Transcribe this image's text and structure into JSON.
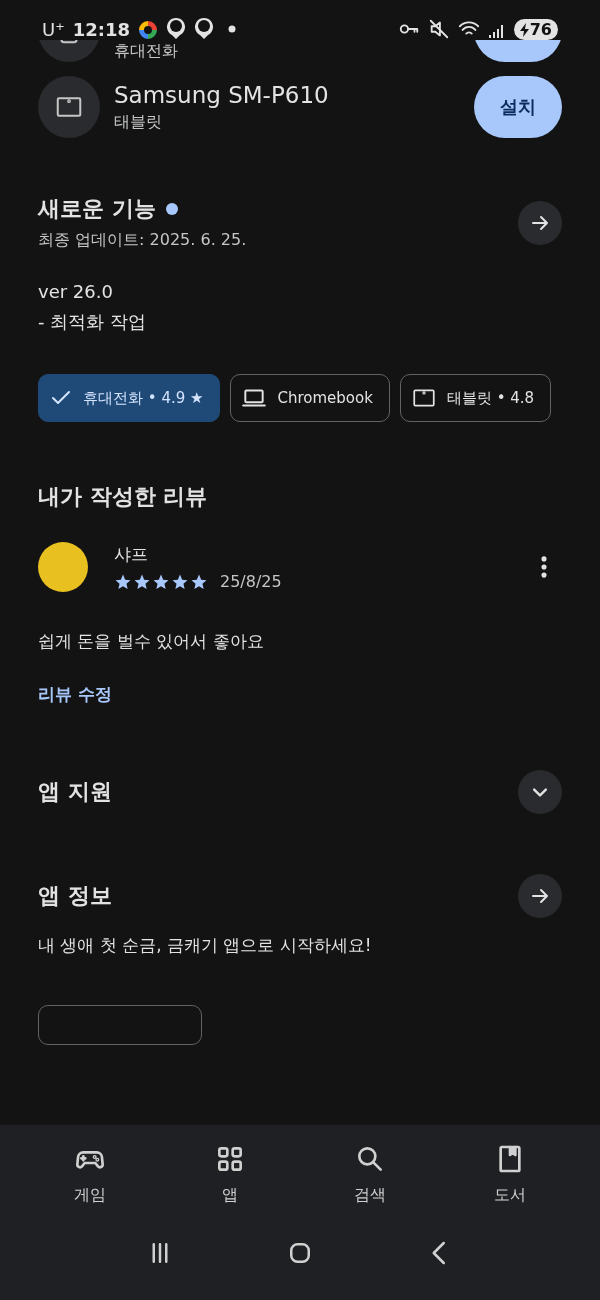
{
  "status_bar": {
    "carrier": "U⁺",
    "time": "12:18",
    "battery": "76"
  },
  "devices": [
    {
      "type": "휴대전화",
      "kind": "phone"
    },
    {
      "name": "Samsung SM-P610",
      "type": "태블릿",
      "kind": "tablet",
      "button": "설치"
    }
  ],
  "whats_new": {
    "title": "새로운 기능",
    "updated": "최종 업데이트: 2025. 6. 25.",
    "lines": [
      "ver 26.0",
      "- 최적화 작업"
    ]
  },
  "device_chips": [
    {
      "label": "휴대전화 • 4.9 ★",
      "selected": true
    },
    {
      "label": "Chromebook",
      "kind": "laptop",
      "selected": false
    },
    {
      "label": "태블릿 • 4.8",
      "kind": "tablet",
      "selected": false
    }
  ],
  "my_review": {
    "title": "내가 작성한 리뷰",
    "author": "샤프",
    "stars": 5,
    "date": "25/8/25",
    "text": "쉽게 돈을 벌수 있어서 좋아요",
    "edit_link": "리뷰 수정"
  },
  "sections": [
    {
      "title": "앱 지원",
      "kind": "expand"
    },
    {
      "title": "앱 정보",
      "kind": "arrow",
      "description": "내 생애 첫 순금, 금캐기 앱으로 시작하세요!"
    }
  ],
  "bottom_nav": [
    {
      "label": "게임",
      "kind": "games"
    },
    {
      "label": "앱",
      "kind": "apps"
    },
    {
      "label": "검색",
      "kind": "search"
    },
    {
      "label": "도서",
      "kind": "books"
    }
  ]
}
